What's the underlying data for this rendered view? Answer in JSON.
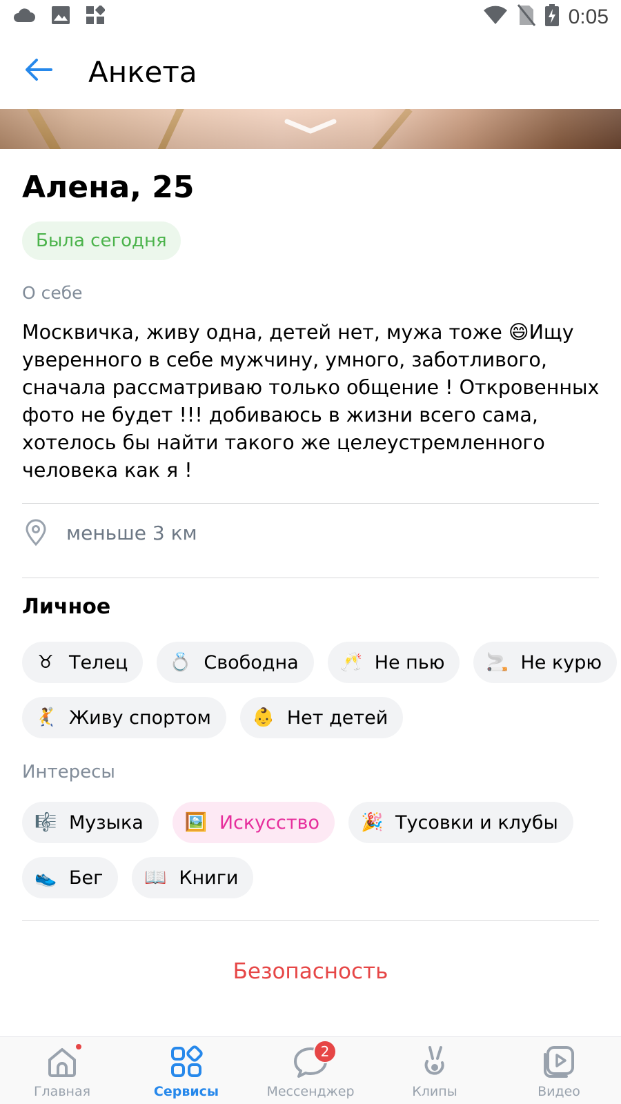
{
  "status_bar": {
    "time": "0:05",
    "left_icons": [
      "cloud-icon",
      "image-icon",
      "apps-icon"
    ],
    "right_icons": [
      "wifi-icon",
      "no-sim-icon",
      "battery-charging-icon"
    ]
  },
  "header": {
    "title": "Анкета",
    "back_icon": "arrow-left-icon"
  },
  "profile": {
    "name": "Алена, 25",
    "online_status": "Была сегодня",
    "about_label": "О себе",
    "about_text": "Москвичка, живу одна, детей нет, мужа тоже 😄Ищу уверенного в себе мужчину, умного, заботливого, сначала рассматриваю только общение ! Откровенных фото не будет !!! добиваюсь в жизни всего сама, хотелось бы найти такого же целеустремленного человека как я !",
    "distance": "меньше 3 км"
  },
  "personal": {
    "title": "Личное",
    "chips": [
      {
        "emoji": "♉",
        "label": "Телец"
      },
      {
        "emoji": "💍",
        "label": "Свободна"
      },
      {
        "emoji": "🥂",
        "label": "Не пью"
      },
      {
        "emoji": "🚬",
        "label": "Не курю"
      },
      {
        "emoji": "🤾",
        "label": "Живу спортом"
      },
      {
        "emoji": "👶",
        "label": "Нет детей"
      }
    ]
  },
  "interests": {
    "title": "Интересы",
    "chips": [
      {
        "emoji": "🎼",
        "label": "Музыка"
      },
      {
        "emoji": "🖼️",
        "label": "Искусство",
        "active": true
      },
      {
        "emoji": "🎉",
        "label": "Тусовки и клубы"
      },
      {
        "emoji": "👟",
        "label": "Бег"
      },
      {
        "emoji": "📖",
        "label": "Книги"
      }
    ]
  },
  "safety_label": "Безопасность",
  "colors": {
    "accent": "#2688eb",
    "online_green": "#4bb34b",
    "danger_red": "#e64646",
    "active_pink": "#e62e9c"
  },
  "bottom_nav": {
    "items": [
      {
        "label": "Главная",
        "icon": "home-icon",
        "has_dot": true
      },
      {
        "label": "Сервисы",
        "icon": "services-icon",
        "active": true
      },
      {
        "label": "Мессенджер",
        "icon": "messenger-icon",
        "badge": "2"
      },
      {
        "label": "Клипы",
        "icon": "clips-icon"
      },
      {
        "label": "Видео",
        "icon": "video-icon"
      }
    ]
  }
}
